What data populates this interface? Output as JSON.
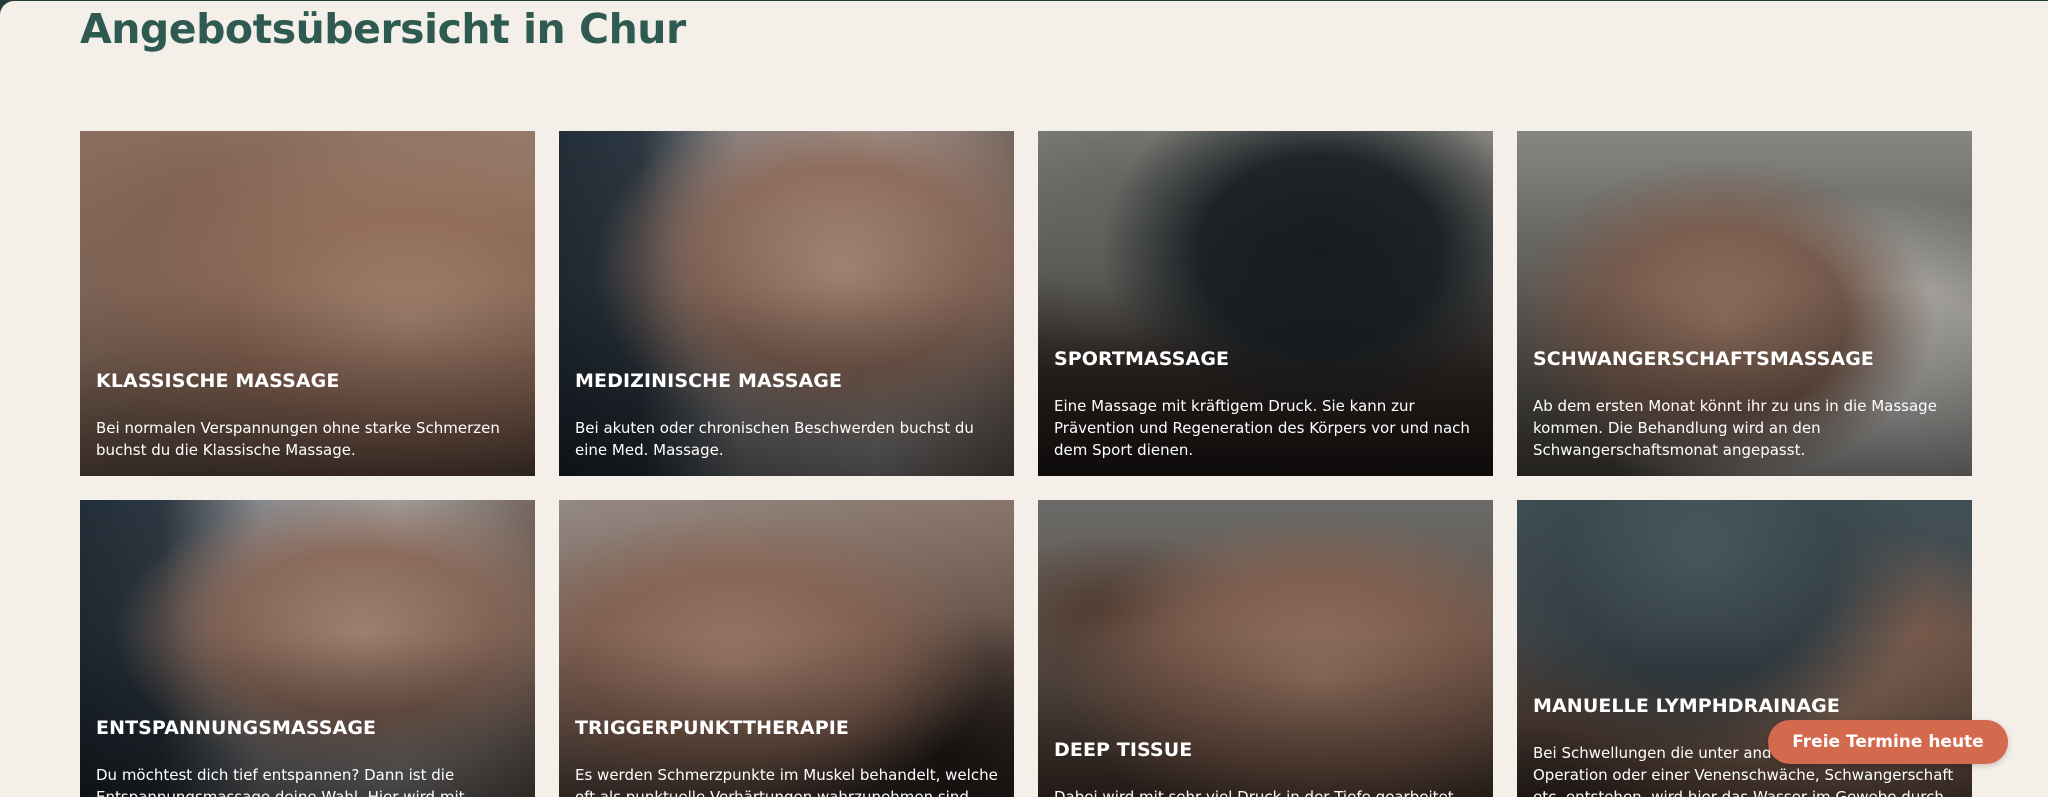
{
  "page": {
    "title": "Angebotsübersicht in Chur"
  },
  "cards": [
    {
      "title": "KLASSISCHE MASSAGE",
      "description": "Bei normalen Verspannungen ohne starke Schmerzen buchst du die Klassische Massage."
    },
    {
      "title": "MEDIZINISCHE MASSAGE",
      "description": "Bei akuten oder chronischen Beschwerden buchst du eine Med. Massage."
    },
    {
      "title": "SPORTMASSAGE",
      "description": "Eine Massage mit kräftigem Druck. Sie kann zur Prävention und Regeneration des Körpers vor und nach dem Sport dienen."
    },
    {
      "title": "SCHWANGERSCHAFTSMASSAGE",
      "description": "Ab dem ersten Monat könnt ihr zu uns in die Massage kommen. Die Behandlung wird an den Schwangerschaftsmonat angepasst."
    },
    {
      "title": "ENTSPANNUNGSMASSAGE",
      "description": "Du möchtest dich tief entspannen? Dann ist die Entspannungsmassage deine Wahl. Hier wird mit"
    },
    {
      "title": "TRIGGERPUNKTTHERAPIE",
      "description": "Es werden Schmerzpunkte im Muskel behandelt, welche oft als punktuelle Verhärtungen wahrzunehmen sind und"
    },
    {
      "title": "DEEP TISSUE",
      "description": "Dabei wird mit sehr viel Druck in der Tiefe gearbeitet und"
    },
    {
      "title": "MANUELLE LYMPHDRAINAGE",
      "description": "Bei Schwellungen die unter anderem nach einer Operation oder einer Venenschwäche, Schwangerschaft etc. entstehen, wird hier das Wasser im Gewebe durch die"
    }
  ],
  "cta": {
    "label": "Freie Termine heute"
  }
}
